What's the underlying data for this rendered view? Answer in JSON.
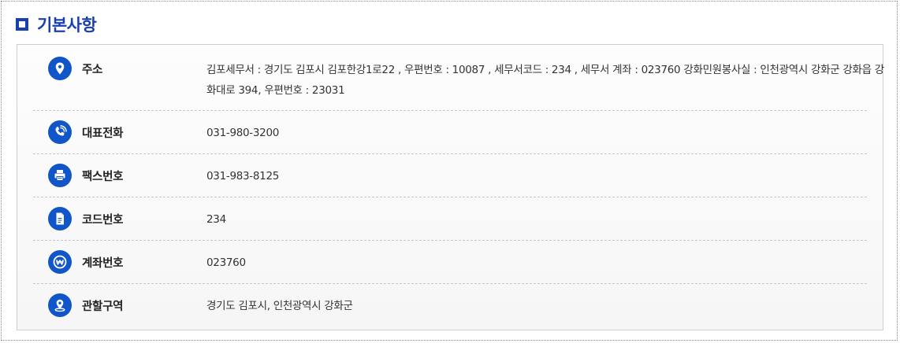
{
  "section": {
    "title": "기본사항"
  },
  "colors": {
    "accent": "#1a3fae",
    "icon_bg": "#1156c9"
  },
  "rows": [
    {
      "icon": "location-pin-icon",
      "label": "주소",
      "value": "김포세무서 : 경기도 김포시 김포한강1로22 , 우편번호 : 10087 , 세무서코드 : 234 , 세무서 계좌 : 023760 강화민원봉사실 : 인천광역시 강화군 강화읍 강화대로 394, 우편번호 : 23031"
    },
    {
      "icon": "phone-icon",
      "label": "대표전화",
      "value": "031-980-3200"
    },
    {
      "icon": "fax-printer-icon",
      "label": "팩스번호",
      "value": "031-983-8125"
    },
    {
      "icon": "document-icon",
      "label": "코드번호",
      "value": "234"
    },
    {
      "icon": "won-currency-icon",
      "label": "계좌번호",
      "value": "023760"
    },
    {
      "icon": "jurisdiction-pin-icon",
      "label": "관할구역",
      "value": "경기도 김포시, 인천광역시 강화군"
    }
  ]
}
